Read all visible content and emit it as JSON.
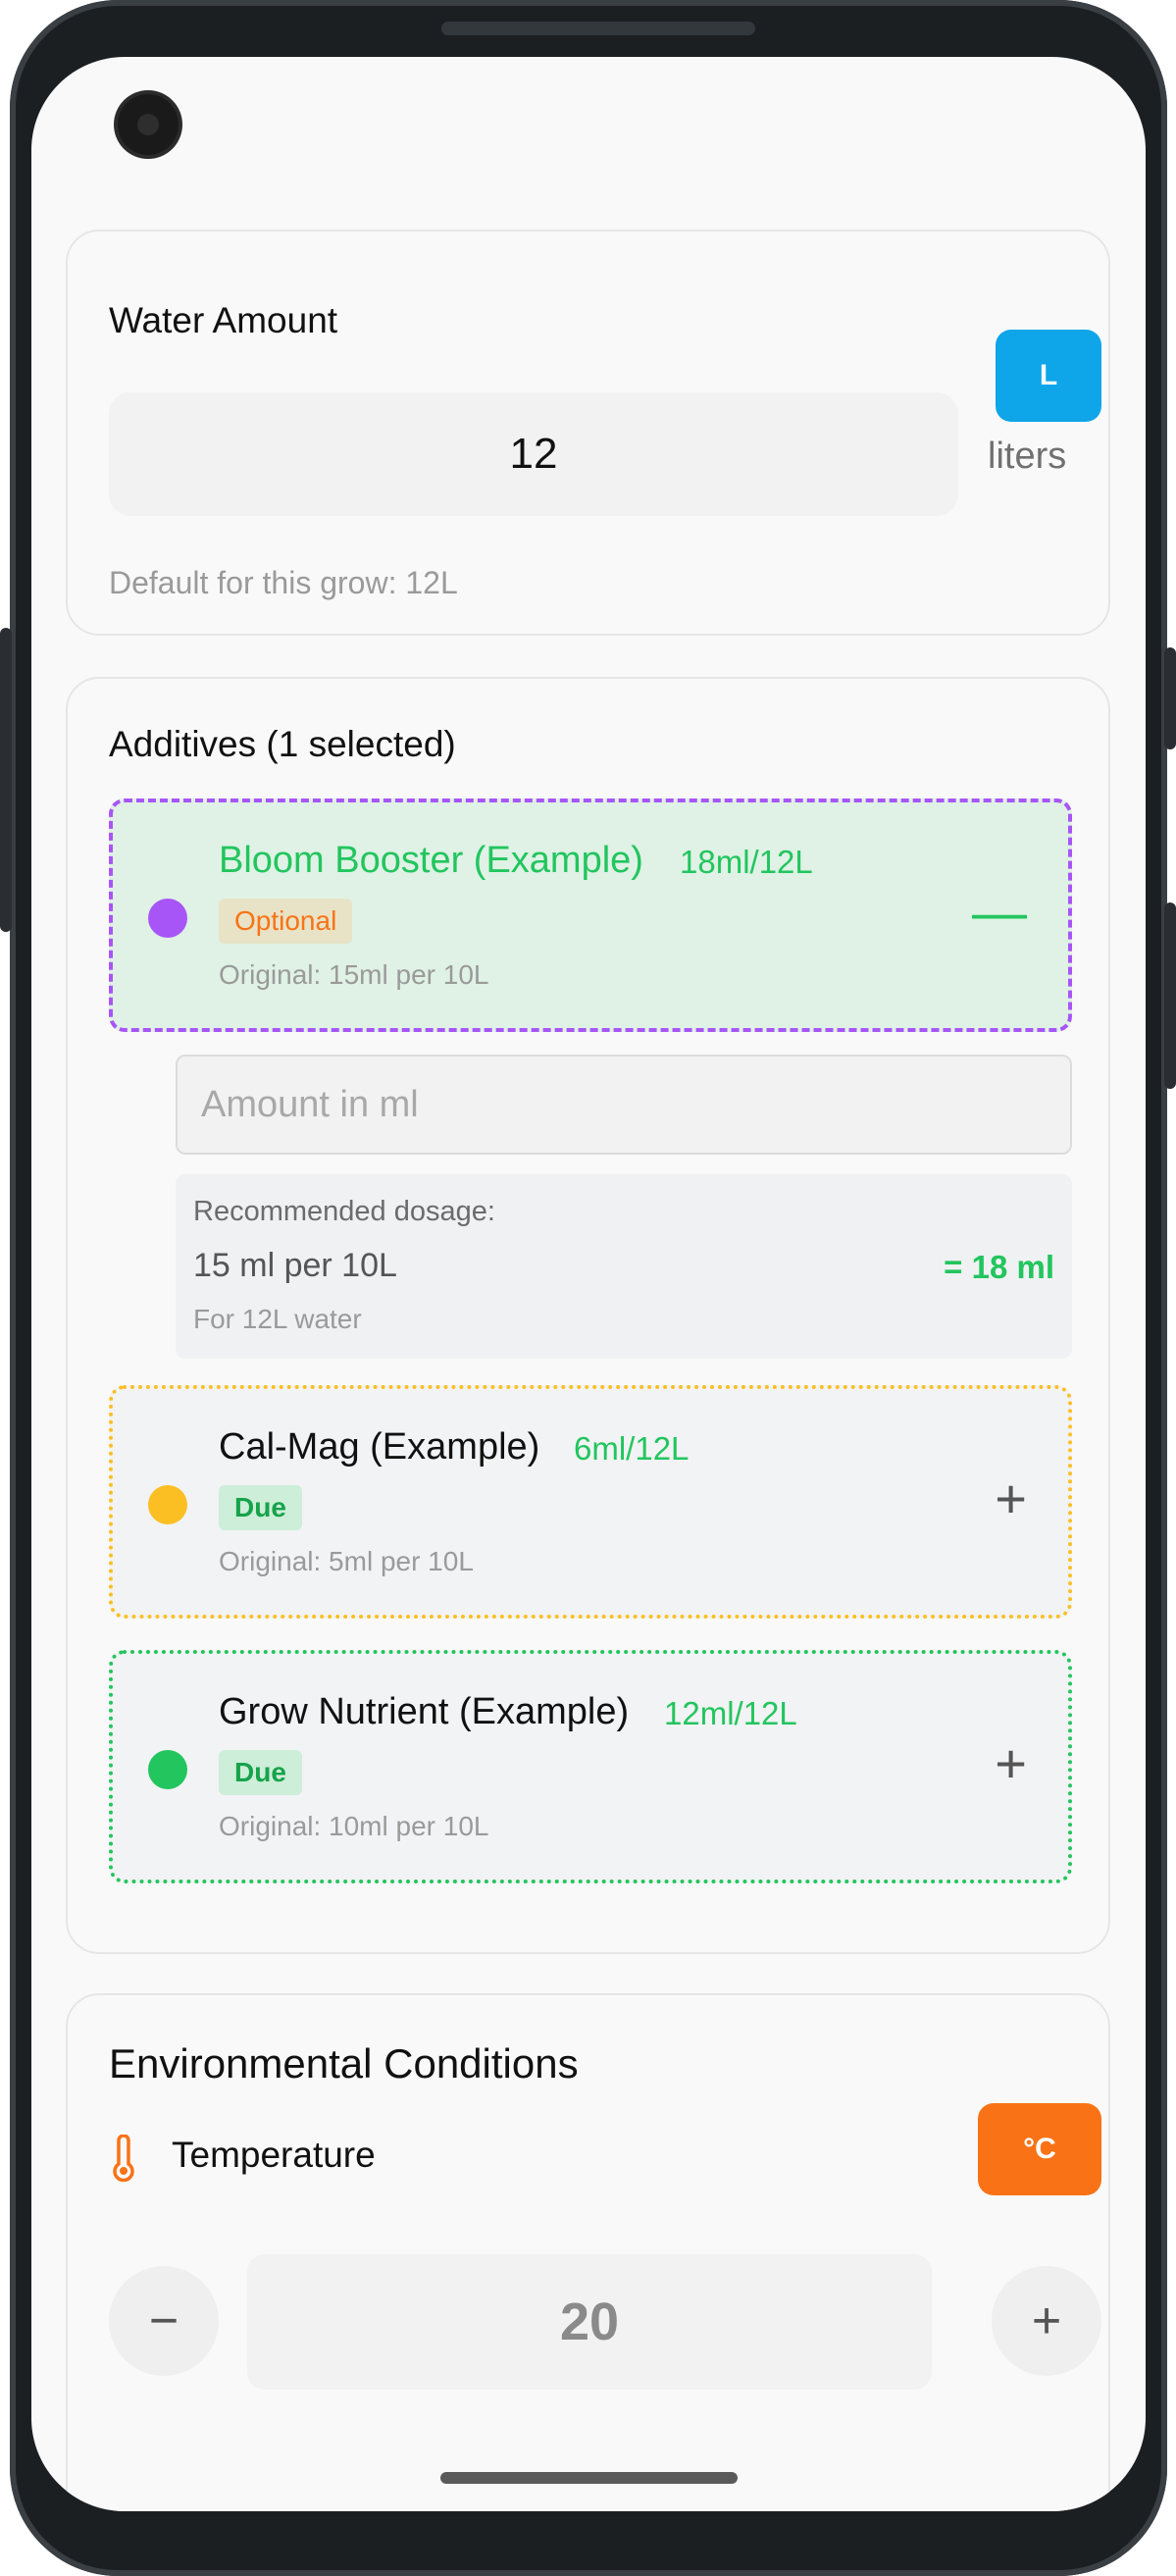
{
  "water": {
    "title": "Water Amount",
    "unit_button": "L",
    "value": "12",
    "unit_label": "liters",
    "default_note": "Default for this grow: 12L"
  },
  "additives": {
    "title": "Additives (1 selected)",
    "items": [
      {
        "name": "Bloom Booster (Example)",
        "amount": "18ml/12L",
        "badge": "Optional",
        "original": "Original: 15ml per 10L",
        "dot_color": "#a855f7",
        "selected": true,
        "toggle": "—"
      },
      {
        "name": "Cal-Mag (Example)",
        "amount": "6ml/12L",
        "badge": "Due",
        "original": "Original: 5ml per 10L",
        "dot_color": "#fbbf24",
        "selected": false,
        "toggle": "+"
      },
      {
        "name": "Grow Nutrient (Example)",
        "amount": "12ml/12L",
        "badge": "Due",
        "original": "Original: 10ml per 10L",
        "dot_color": "#22c55e",
        "selected": false,
        "toggle": "+"
      }
    ],
    "amount_input": {
      "placeholder": "Amount in ml"
    },
    "dosage": {
      "label": "Recommended dosage:",
      "rate": "15 ml per 10L",
      "result": "= 18 ml",
      "note": "For 12L water"
    }
  },
  "environment": {
    "title": "Environmental Conditions",
    "temperature": {
      "label": "Temperature",
      "unit_button": "°C",
      "value": "20",
      "decrement": "−",
      "increment": "+",
      "icon": "thermometer-icon"
    }
  },
  "colors": {
    "accent_blue": "#0ea5e9",
    "accent_orange": "#f97316",
    "green": "#22c55e",
    "purple": "#a855f7",
    "yellow": "#fbbf24"
  }
}
